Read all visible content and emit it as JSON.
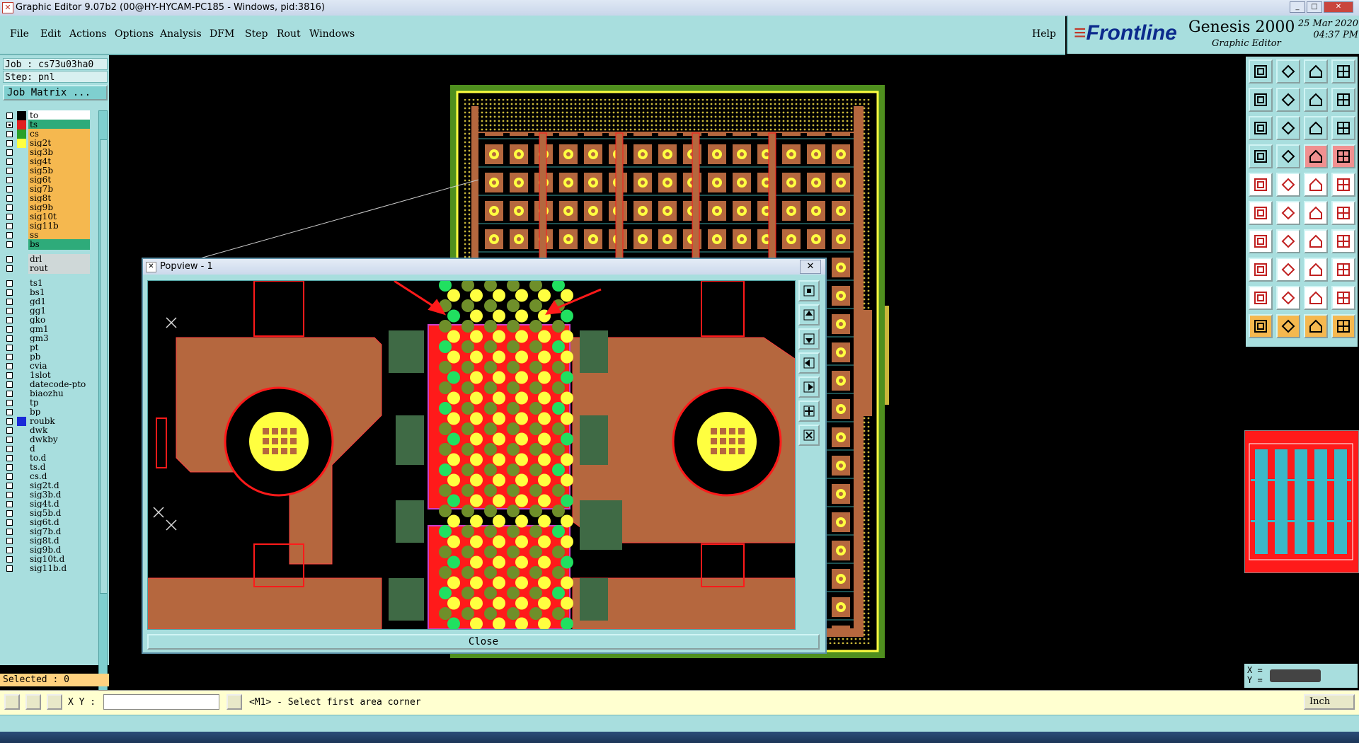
{
  "window": {
    "title": "Graphic Editor 9.07b2 (00@HY-HYCAM-PC185 - Windows, pid:3816)",
    "controls": [
      "_",
      "□",
      "✕"
    ]
  },
  "menu": {
    "items": [
      "File",
      "Edit",
      "Actions",
      "Options",
      "Analysis",
      "DFM",
      "Step",
      "Rout",
      "Windows"
    ],
    "help": "Help"
  },
  "brand": {
    "logo": "Frontline",
    "product": "Genesis 2000",
    "subtitle": "Graphic Editor",
    "date": "25 Mar 2020",
    "time": "04:37 PM"
  },
  "job": {
    "job_label": "Job : cs73u03ha0",
    "step_label": "Step: pnl",
    "matrix_button": "Job Matrix ..."
  },
  "layers": [
    {
      "name": "to",
      "bg": "#ffffff",
      "swatch": "#000000",
      "checked": false
    },
    {
      "name": "ts",
      "bg": "#2eab7a",
      "swatch": "#e02020",
      "checked": true
    },
    {
      "name": "cs",
      "bg": "#f5b84f",
      "swatch": "#2aa02a",
      "checked": false
    },
    {
      "name": "sig2t",
      "bg": "#f5b84f",
      "swatch": "#ffff40",
      "checked": false
    },
    {
      "name": "sig3b",
      "bg": "#f5b84f",
      "swatch": "",
      "checked": false
    },
    {
      "name": "sig4t",
      "bg": "#f5b84f",
      "swatch": "",
      "checked": false
    },
    {
      "name": "sig5b",
      "bg": "#f5b84f",
      "swatch": "",
      "checked": false
    },
    {
      "name": "sig6t",
      "bg": "#f5b84f",
      "swatch": "",
      "checked": false
    },
    {
      "name": "sig7b",
      "bg": "#f5b84f",
      "swatch": "",
      "checked": false
    },
    {
      "name": "sig8t",
      "bg": "#f5b84f",
      "swatch": "",
      "checked": false
    },
    {
      "name": "sig9b",
      "bg": "#f5b84f",
      "swatch": "",
      "checked": false
    },
    {
      "name": "sig10t",
      "bg": "#f5b84f",
      "swatch": "",
      "checked": false
    },
    {
      "name": "sig11b",
      "bg": "#f5b84f",
      "swatch": "",
      "checked": false
    },
    {
      "name": "ss",
      "bg": "#f5b84f",
      "swatch": "",
      "checked": false
    },
    {
      "name": "bs",
      "bg": "#2eab7a",
      "swatch": "",
      "checked": false
    },
    {
      "name": "drl",
      "bg": "#cfd8d8",
      "swatch": "",
      "checked": false,
      "gap": true
    },
    {
      "name": "rout",
      "bg": "#cfd8d8",
      "swatch": "",
      "checked": false
    },
    {
      "name": "ts1",
      "bg": "#a8dede",
      "swatch": "",
      "checked": false,
      "gap": true
    },
    {
      "name": "bs1",
      "bg": "#a8dede",
      "swatch": "",
      "checked": false
    },
    {
      "name": "gd1",
      "bg": "#a8dede",
      "swatch": "",
      "checked": false
    },
    {
      "name": "gg1",
      "bg": "#a8dede",
      "swatch": "",
      "checked": false
    },
    {
      "name": "gko",
      "bg": "#a8dede",
      "swatch": "",
      "checked": false
    },
    {
      "name": "gm1",
      "bg": "#a8dede",
      "swatch": "",
      "checked": false
    },
    {
      "name": "gm3",
      "bg": "#a8dede",
      "swatch": "",
      "checked": false
    },
    {
      "name": "pt",
      "bg": "#a8dede",
      "swatch": "",
      "checked": false
    },
    {
      "name": "pb",
      "bg": "#a8dede",
      "swatch": "",
      "checked": false
    },
    {
      "name": "cvia",
      "bg": "#a8dede",
      "swatch": "",
      "checked": false
    },
    {
      "name": "1slot",
      "bg": "#a8dede",
      "swatch": "",
      "checked": false
    },
    {
      "name": "datecode-pto",
      "bg": "#a8dede",
      "swatch": "",
      "checked": false
    },
    {
      "name": "biaozhu",
      "bg": "#a8dede",
      "swatch": "",
      "checked": false
    },
    {
      "name": "tp",
      "bg": "#a8dede",
      "swatch": "",
      "checked": false
    },
    {
      "name": "bp",
      "bg": "#a8dede",
      "swatch": "",
      "checked": false
    },
    {
      "name": "roubk",
      "bg": "#a8dede",
      "swatch": "#1a2ad8",
      "checked": false
    },
    {
      "name": "dwk",
      "bg": "#a8dede",
      "swatch": "",
      "checked": false
    },
    {
      "name": "dwkby",
      "bg": "#a8dede",
      "swatch": "",
      "checked": false
    },
    {
      "name": "d",
      "bg": "#a8dede",
      "swatch": "",
      "checked": false
    },
    {
      "name": "to.d",
      "bg": "#a8dede",
      "swatch": "",
      "checked": false
    },
    {
      "name": "ts.d",
      "bg": "#a8dede",
      "swatch": "",
      "checked": false
    },
    {
      "name": "cs.d",
      "bg": "#a8dede",
      "swatch": "",
      "checked": false
    },
    {
      "name": "sig2t.d",
      "bg": "#a8dede",
      "swatch": "",
      "checked": false
    },
    {
      "name": "sig3b.d",
      "bg": "#a8dede",
      "swatch": "",
      "checked": false
    },
    {
      "name": "sig4t.d",
      "bg": "#a8dede",
      "swatch": "",
      "checked": false
    },
    {
      "name": "sig5b.d",
      "bg": "#a8dede",
      "swatch": "",
      "checked": false
    },
    {
      "name": "sig6t.d",
      "bg": "#a8dede",
      "swatch": "",
      "checked": false
    },
    {
      "name": "sig7b.d",
      "bg": "#a8dede",
      "swatch": "",
      "checked": false
    },
    {
      "name": "sig8t.d",
      "bg": "#a8dede",
      "swatch": "",
      "checked": false
    },
    {
      "name": "sig9b.d",
      "bg": "#a8dede",
      "swatch": "",
      "checked": false
    },
    {
      "name": "sig10t.d",
      "bg": "#a8dede",
      "swatch": "",
      "checked": false
    },
    {
      "name": "sig11b.d",
      "bg": "#a8dede",
      "swatch": "",
      "checked": false
    }
  ],
  "selected": "Selected : 0",
  "popview": {
    "title": "Popview - 1",
    "close_button": "Close"
  },
  "status": {
    "xy_label": "X Y :",
    "xy_value": "",
    "prompt": "<M1> - Select first area corner",
    "units": "Inch"
  },
  "readout": {
    "x_label": "X =",
    "y_label": "Y ="
  },
  "colors": {
    "panel": "#a8dede",
    "board_copper": "#b5673e",
    "board_frame": "#4f8f1e",
    "highlight_red": "#ff1a1a",
    "drill_yellow": "#ffff40",
    "pad_green": "#20e060"
  }
}
